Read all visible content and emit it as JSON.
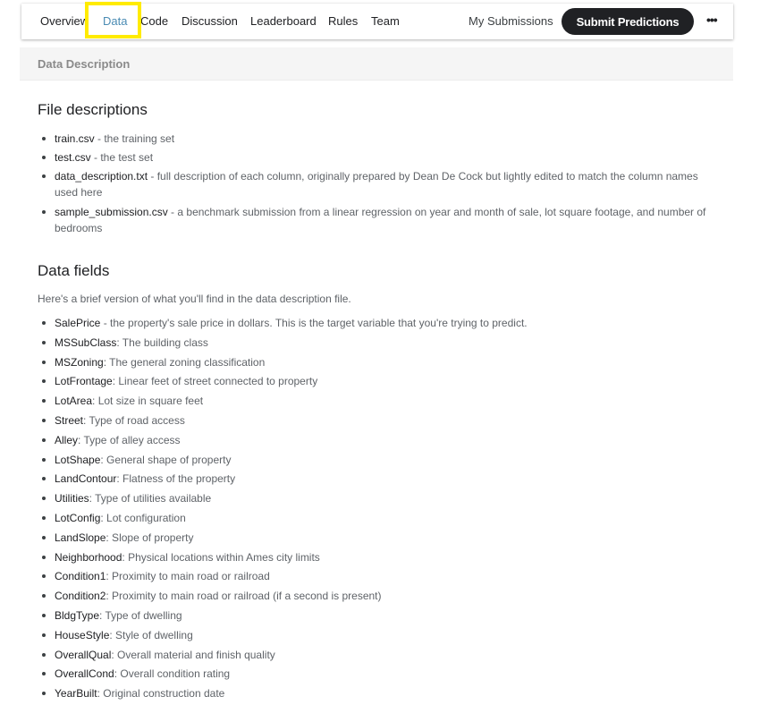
{
  "nav": {
    "tabs": [
      {
        "label": "Overview",
        "active": false
      },
      {
        "label": "Data",
        "active": true
      },
      {
        "label": "Code",
        "active": false
      },
      {
        "label": "Discussion",
        "active": false
      },
      {
        "label": "Leaderboard",
        "active": false
      },
      {
        "label": "Rules",
        "active": false
      },
      {
        "label": "Team",
        "active": false
      }
    ],
    "my_submissions": "My Submissions",
    "submit_button": "Submit Predictions",
    "more_icon": "•••",
    "active_color": "#4a8bb3",
    "highlight_color": "#ffeb00"
  },
  "section_header": "Data Description",
  "file_descriptions": {
    "title": "File descriptions",
    "items": [
      {
        "name": "train.csv",
        "desc": " - the training set"
      },
      {
        "name": "test.csv",
        "desc": " - the test set"
      },
      {
        "name": "data_description.txt",
        "desc": " - full description of each column, originally prepared by Dean De Cock but lightly edited to match the column names used here"
      },
      {
        "name": "sample_submission.csv",
        "desc": " - a benchmark submission from a linear regression on year and month of sale, lot square footage, and number of bedrooms"
      }
    ]
  },
  "data_fields": {
    "title": "Data fields",
    "intro": "Here's a brief version of what you'll find in the data description file.",
    "items": [
      {
        "name": "SalePrice",
        "desc": " - the property's sale price in dollars. This is the target variable that you're trying to predict."
      },
      {
        "name": "MSSubClass",
        "desc": ": The building class"
      },
      {
        "name": "MSZoning",
        "desc": ": The general zoning classification"
      },
      {
        "name": "LotFrontage",
        "desc": ": Linear feet of street connected to property"
      },
      {
        "name": "LotArea",
        "desc": ": Lot size in square feet"
      },
      {
        "name": "Street",
        "desc": ": Type of road access"
      },
      {
        "name": "Alley",
        "desc": ": Type of alley access"
      },
      {
        "name": "LotShape",
        "desc": ": General shape of property"
      },
      {
        "name": "LandContour",
        "desc": ": Flatness of the property"
      },
      {
        "name": "Utilities",
        "desc": ": Type of utilities available"
      },
      {
        "name": "LotConfig",
        "desc": ": Lot configuration"
      },
      {
        "name": "LandSlope",
        "desc": ": Slope of property"
      },
      {
        "name": "Neighborhood",
        "desc": ": Physical locations within Ames city limits"
      },
      {
        "name": "Condition1",
        "desc": ": Proximity to main road or railroad"
      },
      {
        "name": "Condition2",
        "desc": ": Proximity to main road or railroad (if a second is present)"
      },
      {
        "name": "BldgType",
        "desc": ": Type of dwelling"
      },
      {
        "name": "HouseStyle",
        "desc": ": Style of dwelling"
      },
      {
        "name": "OverallQual",
        "desc": ": Overall material and finish quality"
      },
      {
        "name": "OverallCond",
        "desc": ": Overall condition rating"
      },
      {
        "name": "YearBuilt",
        "desc": ": Original construction date"
      }
    ]
  }
}
